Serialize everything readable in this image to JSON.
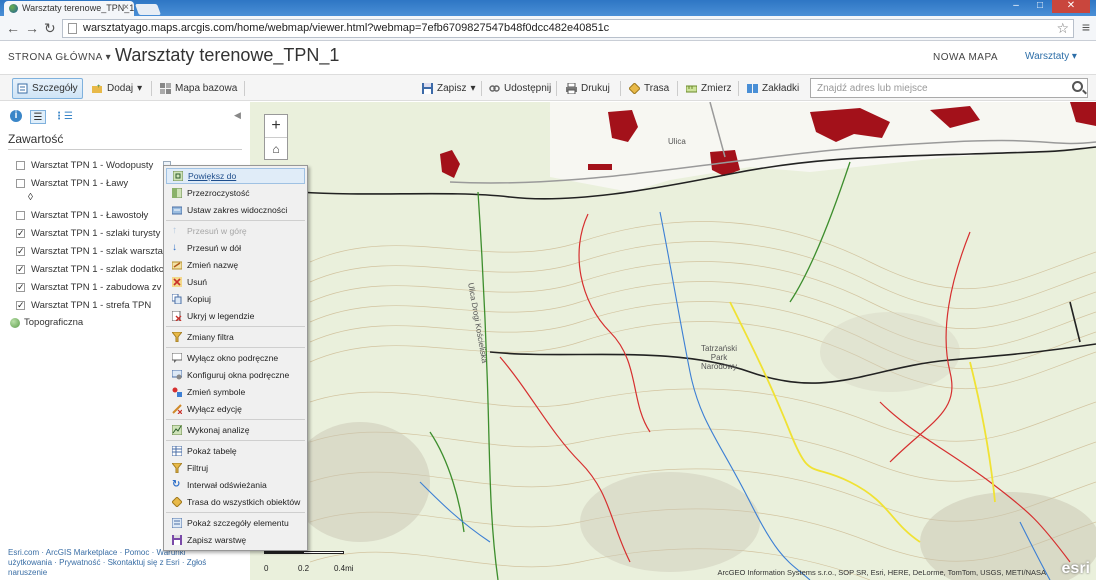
{
  "browser": {
    "tab_title": "Warsztaty terenowe_TPN_1",
    "url": "warsztatyago.maps.arcgis.com/home/webmap/viewer.html?webmap=7efb6709827547b48f0dcc482e40851c"
  },
  "header": {
    "home_label": "STRONA GŁÓWNA",
    "title": "Warsztaty terenowe_TPN_1",
    "new_map_label": "NOWA MAPA",
    "user_label": "Warsztaty"
  },
  "toolbar": {
    "details": "Szczegóły",
    "add": "Dodaj",
    "basemap": "Mapa bazowa",
    "save": "Zapisz",
    "share": "Udostępnij",
    "print": "Drukuj",
    "directions": "Trasa",
    "measure": "Zmierz",
    "bookmarks": "Zakładki",
    "search_placeholder": "Znajdź adres lub miejsce"
  },
  "panel": {
    "title": "Zawartość",
    "layers": [
      {
        "label": "Warsztat TPN 1 - Wodopusty",
        "checked": false
      },
      {
        "label": "Warsztat TPN 1 - Ławy",
        "checked": false
      },
      {
        "label": "Warsztat TPN 1 - Ławostoły",
        "checked": false
      },
      {
        "label": "Warsztat TPN 1 - szlaki turysty",
        "checked": true
      },
      {
        "label": "Warsztat TPN 1 - szlak warszta",
        "checked": true
      },
      {
        "label": "Warsztat TPN 1 - szlak dodatkc",
        "checked": true
      },
      {
        "label": "Warsztat TPN 1 - zabudowa zv",
        "checked": true
      },
      {
        "label": "Warsztat TPN 1 - strefa TPN",
        "checked": true
      }
    ],
    "basemap_label": "Topograficzna",
    "footer_text": "Esri.com · ArcGIS Marketplace · Pomoc · Warunki użytkowania · Prywatność · Skontaktuj się z Esri · Zgłoś naruszenie"
  },
  "context_menu": [
    {
      "label": "Powiększ do",
      "state": "hover"
    },
    {
      "label": "Przezroczystość",
      "state": "normal"
    },
    {
      "label": "Ustaw zakres widoczności",
      "state": "normal"
    },
    {
      "label": "Przesuń w górę",
      "state": "disabled"
    },
    {
      "label": "Przesuń w dół",
      "state": "normal"
    },
    {
      "label": "Zmień nazwę",
      "state": "normal"
    },
    {
      "label": "Usuń",
      "state": "normal"
    },
    {
      "label": "Kopiuj",
      "state": "normal"
    },
    {
      "label": "Ukryj w legendzie",
      "state": "normal"
    },
    {
      "label": "Zmiany filtra",
      "state": "normal"
    },
    {
      "label": "Wyłącz okno podręczne",
      "state": "normal"
    },
    {
      "label": "Konfiguruj okna podręczne",
      "state": "normal"
    },
    {
      "label": "Zmień symbole",
      "state": "normal"
    },
    {
      "label": "Wyłącz edycję",
      "state": "normal"
    },
    {
      "label": "Wykonaj analizę",
      "state": "normal"
    },
    {
      "label": "Pokaż tabelę",
      "state": "normal"
    },
    {
      "label": "Filtruj",
      "state": "normal"
    },
    {
      "label": "Interwał odświeżania",
      "state": "normal"
    },
    {
      "label": "Trasa do wszystkich obiektów",
      "state": "normal"
    },
    {
      "label": "Pokaż szczegóły elementu",
      "state": "normal"
    },
    {
      "label": "Zapisz warstwę",
      "state": "normal"
    }
  ],
  "map": {
    "road_label": "Ulica Drogi Kościeliska",
    "ulica_label": "Ulica",
    "park_label": "Tatrzański Park Narodowy",
    "scale_labels": [
      "0",
      "0.2",
      "0.4mi"
    ],
    "attribution": "ArcGEO Information Systems s.r.o., SOP SR, Esri, HERE, DeLorme, TomTom, USGS, METI/NASA",
    "esri_logo": "esri"
  }
}
